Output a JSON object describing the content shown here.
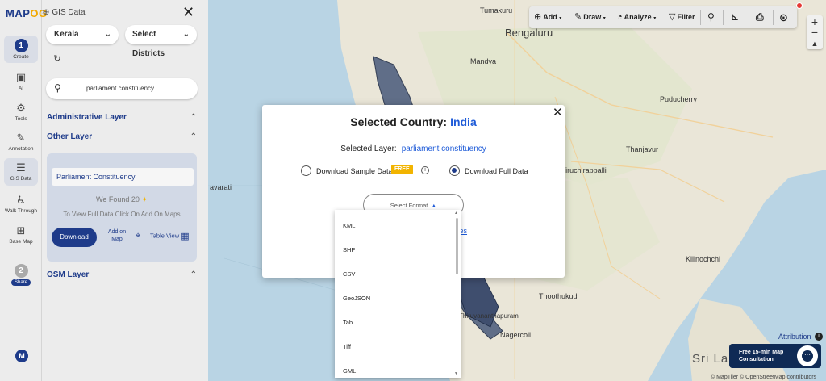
{
  "app": {
    "logo_text": "MAP",
    "logo_accent": "OG",
    "breadcrumb": "GIS Data"
  },
  "rail": {
    "create": {
      "step": "1",
      "label": "Create"
    },
    "ai": "AI",
    "tools": "Tools",
    "annotation": "Annotation",
    "gis_data": "GIS Data",
    "walk_through": "Walk Through",
    "base_map": "Base Map",
    "share": {
      "step": "2",
      "label": "Share"
    },
    "avatar": "M"
  },
  "panel": {
    "state_select": "Kerala",
    "district_select": "Select Districts",
    "search_value": "parliament constituency",
    "admin_layer": "Administrative Layer",
    "other_layer": "Other Layer",
    "osm_layer": "OSM Layer",
    "layer_name": "Parliament Constituency",
    "found_prefix": "We Found",
    "found_count": "20",
    "hint": "To View Full Data Click On Add On Maps",
    "download_label": "Download",
    "add_on_map_1": "Add on",
    "add_on_map_2": "Map",
    "table_view": "Table View"
  },
  "toolbar": {
    "add": "Add",
    "draw": "Draw",
    "analyze": "Analyze",
    "filter": "Filter"
  },
  "modal": {
    "title_prefix": "Selected Country:",
    "country": "India",
    "layer_prefix": "Selected Layer:",
    "layer_value": "parliament constituency",
    "sample_label": "Download Sample Data",
    "free_badge": "FREE",
    "full_label": "Download Full Data",
    "format_placeholder": "Select Format",
    "partial_link": "ses",
    "selected_option": "full"
  },
  "formats": [
    "KML",
    "SHP",
    "CSV",
    "GeoJSON",
    "Tab",
    "Tiff",
    "GML"
  ],
  "map": {
    "labels": {
      "tumakuru": "Tumakuru",
      "bengaluru": "Bengaluru",
      "mandya": "Mandya",
      "puducherry": "Puducherry",
      "tiruchirappalli": "Tiruchirappalli",
      "thanjavur": "Thanjavur",
      "avarati": "avarati",
      "thoothukudi": "Thoothukudi",
      "kilinochchi": "Kilinochchi",
      "nagercoil": "Nagercoil",
      "tvm": "Thiruvananthapuram",
      "sri_lanka": "Sri Lank"
    }
  },
  "attribution": "Attribution",
  "consult": {
    "line1": "Free 15-min Map",
    "line2": "Consultation"
  },
  "copyright": "© MapTiler © OpenStreetMap contributors",
  "colors": {
    "brand": "#1e3b8a",
    "link": "#1e5bd8",
    "free": "#f2b400",
    "sea": "#b9d4e4",
    "land": "#eae6d8"
  }
}
